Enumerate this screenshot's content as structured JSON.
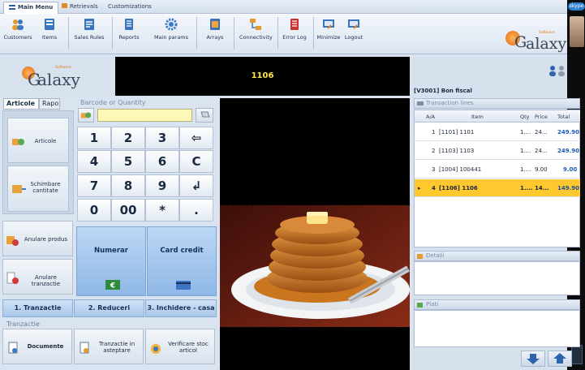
{
  "menu": {
    "tabs": [
      {
        "label": "Main Menu",
        "active": true
      },
      {
        "label": "Retrievals",
        "active": false
      },
      {
        "label": "Customizations",
        "active": false
      }
    ]
  },
  "ribbon": {
    "buttons": [
      {
        "label": "Customers",
        "icon": "users-icon"
      },
      {
        "label": "Items",
        "icon": "items-icon"
      },
      {
        "label": "Sales Rules",
        "icon": "sales-rules-icon"
      },
      {
        "label": "Reports",
        "icon": "reports-icon"
      },
      {
        "label": "Main params",
        "icon": "gear-icon"
      },
      {
        "label": "Arrays",
        "icon": "arrays-icon"
      },
      {
        "label": "Connectivity",
        "icon": "connectivity-icon"
      },
      {
        "label": "Error Log",
        "icon": "error-log-icon"
      },
      {
        "label": "Minimize",
        "icon": "minimize-icon"
      },
      {
        "label": "Logout",
        "icon": "logout-icon"
      }
    ]
  },
  "brand": {
    "name": "alaxy",
    "tagline": "Software"
  },
  "skype": {
    "badge": "skype"
  },
  "display": {
    "text": "1106"
  },
  "left": {
    "tabs": [
      {
        "label": "Articole",
        "active": true
      },
      {
        "label": "Rapo",
        "active": false
      }
    ],
    "items": [
      {
        "label": "Articole",
        "icon": "articles-icon"
      },
      {
        "label": "Schimbare cantitate",
        "icon": "quantity-change-icon"
      },
      {
        "label": "Anulare produs",
        "icon": "cancel-product-icon"
      },
      {
        "label": "Anulare tranzactie",
        "icon": "cancel-transaction-icon"
      }
    ]
  },
  "keypad": {
    "barcode_label": "Barcode or Quantity",
    "barcode_value": "",
    "keys": [
      "1",
      "2",
      "3",
      "⇦",
      "4",
      "5",
      "6",
      "C",
      "7",
      "8",
      "9",
      "↲",
      "0",
      "00",
      "*",
      "."
    ]
  },
  "payment": {
    "cash": {
      "label": "Numerar",
      "icon": "euro-note-icon"
    },
    "card": {
      "label": "Card credit",
      "icon": "credit-card-icon"
    }
  },
  "steps": [
    {
      "label": "1. Tranzactie"
    },
    {
      "label": "2. Reduceri"
    },
    {
      "label": "3. Inchidere - casa"
    }
  ],
  "tranzactie": {
    "label": "Tranzactie",
    "buttons": [
      {
        "label": "Documente",
        "icon": "documents-icon"
      },
      {
        "label": "Tranzactie in asteptare",
        "icon": "pending-transaction-icon"
      },
      {
        "label": "Verificare stoc articol",
        "icon": "stock-check-icon"
      }
    ]
  },
  "receipt": {
    "title": "[V3001] Bon fiscal",
    "section_lines": "Transaction lines",
    "columns": [
      "A/A",
      "Item",
      "Qty",
      "Price",
      "Total"
    ],
    "rows": [
      {
        "aa": "1",
        "item": "[1101] 1101",
        "qty": "1....",
        "price": "24...",
        "total": "249.90",
        "selected": false
      },
      {
        "aa": "2",
        "item": "[1103] 1103",
        "qty": "1....",
        "price": "24...",
        "total": "249.90",
        "selected": false
      },
      {
        "aa": "3",
        "item": "[1004] 100441",
        "qty": "1....",
        "price": "9.00",
        "total": "9.00",
        "selected": false
      },
      {
        "aa": "4",
        "item": "[1106] 1106",
        "qty": "1....",
        "price": "14...",
        "total": "149.90",
        "selected": true
      }
    ],
    "section_details": "Detalii",
    "section_payments": "Plati"
  },
  "colors": {
    "accent_orange": "#e26e14",
    "selected_row": "#ffc82e",
    "display_text": "#ffe34a",
    "barcode_field": "#fff9b8"
  }
}
